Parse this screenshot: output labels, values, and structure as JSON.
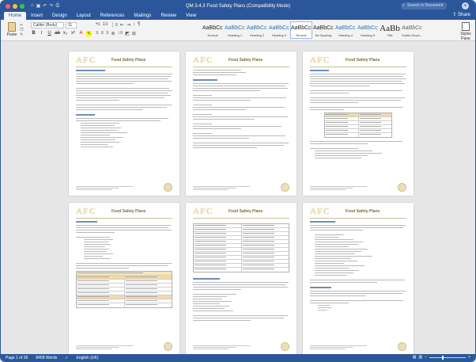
{
  "window": {
    "title": "QM 3.4.3 Food Safety Plans (Compatibility Mode)",
    "search_placeholder": "Search in Document",
    "share": "Share"
  },
  "tabs": [
    "Home",
    "Insert",
    "Design",
    "Layout",
    "References",
    "Mailings",
    "Review",
    "View"
  ],
  "ribbon": {
    "paste": "Paste",
    "font_name": "Calibri (Body)",
    "font_size": "11",
    "styles": [
      {
        "preview": "AaBbCcDdEe",
        "name": "Normal"
      },
      {
        "preview": "AaBbCcDdEe",
        "name": "Heading 1"
      },
      {
        "preview": "AaBbCcDdEe",
        "name": "Heading 2"
      },
      {
        "preview": "AaBbCcDdEe",
        "name": "Heading 3"
      },
      {
        "preview": "AaBbCcDdEe",
        "name": "Normal"
      },
      {
        "preview": "AaBbCcDe",
        "name": "No Spacing"
      },
      {
        "preview": "AaBbCcDdEe",
        "name": "Heading 4"
      },
      {
        "preview": "AaBbCcDdEe",
        "name": "Heading 5"
      },
      {
        "preview": "AaBb",
        "name": "Title"
      },
      {
        "preview": "AaBbCcDdEe",
        "name": "Subtle Emph..."
      }
    ],
    "styles_pane": "Styles Pane"
  },
  "pages": [
    {
      "logo": "AFC",
      "title": "Food Safety Plans"
    },
    {
      "logo": "AFC",
      "title": "Food Safety Plans"
    },
    {
      "logo": "AFC",
      "title": "Food Safety Plans"
    },
    {
      "logo": "AFC",
      "title": "Food Safety Plans"
    },
    {
      "logo": "AFC",
      "title": "Food Safety Plans"
    },
    {
      "logo": "AFC",
      "title": "Food Safety Plans"
    }
  ],
  "status": {
    "page": "Page 1 of 36",
    "words": "8458 Words",
    "language": "English (UK)"
  },
  "colors": {
    "accent": "#2b579a",
    "ribbon": "#f3f3f3",
    "workspace": "#e6e6e6"
  }
}
